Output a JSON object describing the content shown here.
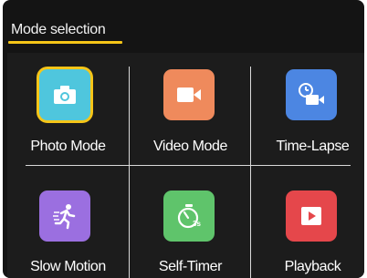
{
  "header": {
    "title": "Mode selection"
  },
  "colors": {
    "accent": "#f5c518"
  },
  "modes": [
    {
      "label": "Photo Mode",
      "icon": "camera-icon",
      "color": "#4fc6dd",
      "selected": true
    },
    {
      "label": "Video Mode",
      "icon": "video-camera-icon",
      "color": "#ef8a5c",
      "selected": false
    },
    {
      "label": "Time-Lapse",
      "icon": "time-lapse-icon",
      "color": "#4c86e2",
      "selected": false
    },
    {
      "label": "Slow Motion",
      "icon": "running-person-icon",
      "color": "#9b6fe0",
      "selected": false
    },
    {
      "label": "Self-Timer",
      "icon": "timer-3s-icon",
      "color": "#5fc46b",
      "selected": false
    },
    {
      "label": "Playback",
      "icon": "play-icon",
      "color": "#e5474b",
      "selected": false
    }
  ]
}
